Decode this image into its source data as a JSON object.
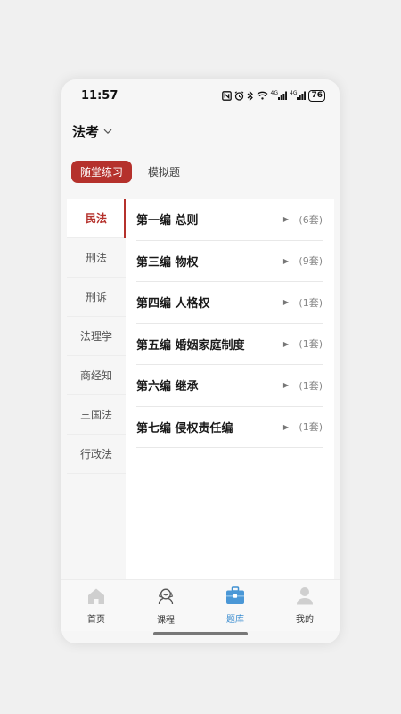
{
  "status_bar": {
    "time": "11:57",
    "signal1_label": "4G",
    "signal2_label": "4G",
    "battery": "76"
  },
  "header": {
    "subject": "法考"
  },
  "tabs": [
    {
      "label": "随堂练习",
      "active": true
    },
    {
      "label": "模拟题",
      "active": false
    }
  ],
  "sidebar": {
    "items": [
      {
        "label": "民法",
        "active": true
      },
      {
        "label": "刑法",
        "active": false
      },
      {
        "label": "刑诉",
        "active": false
      },
      {
        "label": "法理学",
        "active": false
      },
      {
        "label": "商经知",
        "active": false
      },
      {
        "label": "三国法",
        "active": false
      },
      {
        "label": "行政法",
        "active": false
      }
    ]
  },
  "chapters": [
    {
      "title": "第一编 总则",
      "count": "(6套)"
    },
    {
      "title": "第三编 物权",
      "count": "(9套)"
    },
    {
      "title": "第四编 人格权",
      "count": "(1套)"
    },
    {
      "title": "第五编 婚姻家庭制度",
      "count": "(1套)"
    },
    {
      "title": "第六编 继承",
      "count": "(1套)"
    },
    {
      "title": "第七编 侵权责任编",
      "count": "(1套)"
    }
  ],
  "bottom_nav": [
    {
      "label": "首页",
      "icon": "home-icon",
      "active": false
    },
    {
      "label": "课程",
      "icon": "course-icon",
      "active": false
    },
    {
      "label": "题库",
      "icon": "question-bank-icon",
      "active": true
    },
    {
      "label": "我的",
      "icon": "profile-icon",
      "active": false
    }
  ],
  "colors": {
    "accent": "#b5312c",
    "nav_active": "#3f8fd1"
  }
}
